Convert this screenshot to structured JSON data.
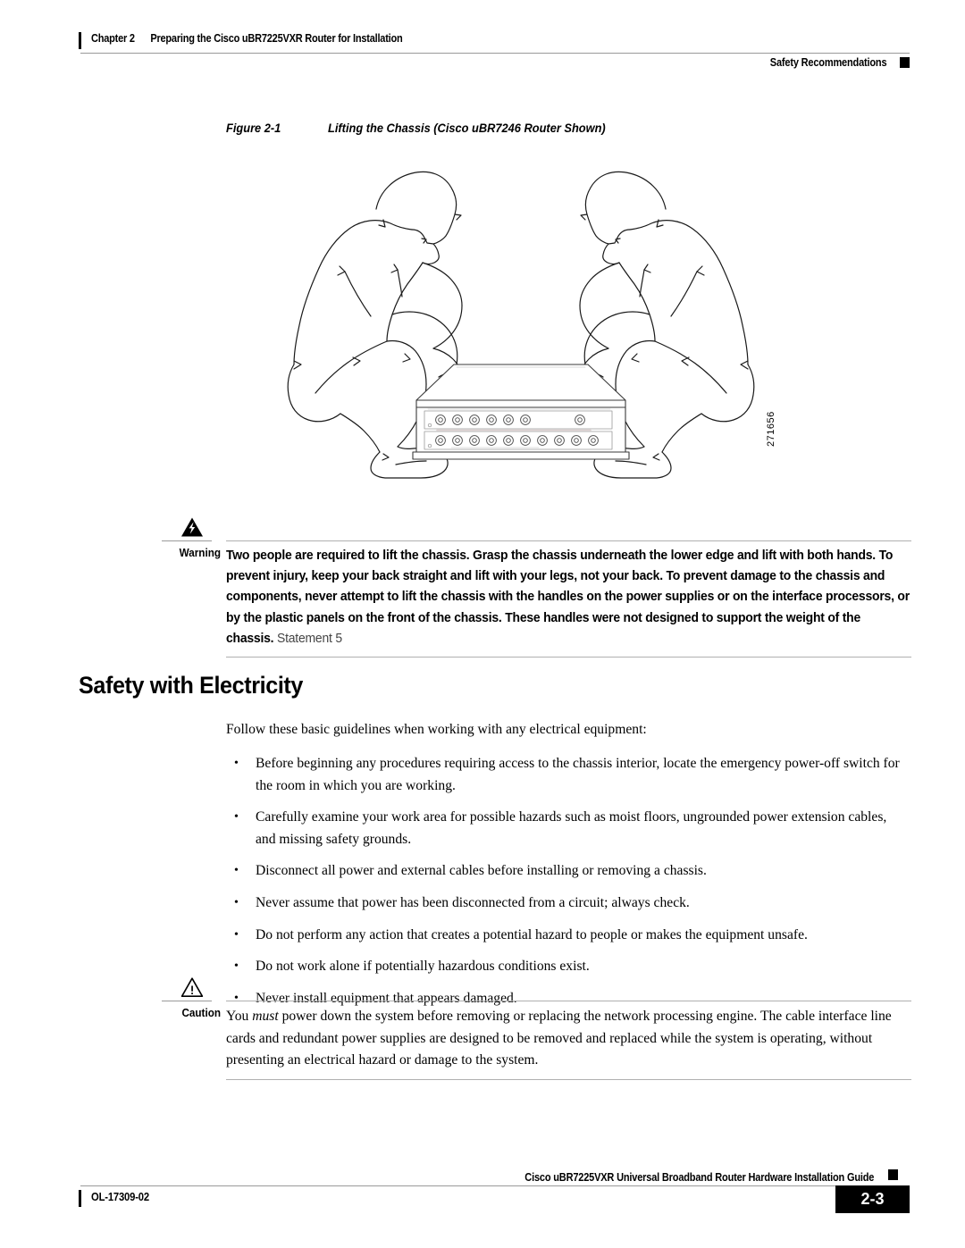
{
  "header": {
    "chapter": "Chapter 2",
    "chapter_title": "Preparing the Cisco uBR7225VXR Router for Installation",
    "section_marker": "Safety Recommendations"
  },
  "figure": {
    "number": "Figure 2-1",
    "title": "Lifting the Chassis (Cisco uBR7246 Router Shown)",
    "art_id": "271656",
    "alt": "Line drawing of two people crouching on either side of a rack-mount router chassis, grasping it underneath the lower edge with both hands"
  },
  "warning": {
    "label": "Warning",
    "icon": "warning-lightning-triangle-icon",
    "text": "Two people are required to lift the chassis. Grasp the chassis underneath the lower edge and lift with both hands. To prevent injury, keep your back straight and lift with your legs, not your back. To prevent damage to the chassis and components, never attempt to lift the chassis with the handles on the power supplies or on the interface processors, or by the plastic panels on the front of the chassis. These handles were not designed to support the weight of the chassis.",
    "statement": "Statement 5"
  },
  "section": {
    "heading": "Safety with Electricity",
    "lead": "Follow these basic guidelines when working with any electrical equipment:",
    "bullet_char": "•",
    "bullets": [
      "Before beginning any procedures requiring access to the chassis interior, locate the emergency power-off switch for the room in which you are working.",
      "Carefully examine your work area for possible hazards such as moist floors, ungrounded power extension cables, and missing safety grounds.",
      "Disconnect all power and external cables before installing or removing a chassis.",
      "Never assume that power has been disconnected from a circuit; always check.",
      "Do not perform any action that creates a potential hazard to people or makes the equipment unsafe.",
      "Do not work alone if potentially hazardous conditions exist.",
      "Never install equipment that appears damaged."
    ]
  },
  "caution": {
    "label": "Caution",
    "icon": "caution-exclamation-triangle-icon",
    "text_before": "You ",
    "emphasis": "must",
    "text_after": " power down the system before removing or replacing the network processing engine. The cable interface line cards and redundant power supplies are designed to be removed and replaced while the system is operating, without presenting an electrical hazard or damage to the system."
  },
  "footer": {
    "guide_title": "Cisco uBR7225VXR Universal Broadband Router Hardware Installation Guide",
    "doc_id": "OL-17309-02",
    "page_number": "2-3"
  },
  "colors": {
    "text": "#000000",
    "rule": "#9a9a9a",
    "page_box": "#000000",
    "statement_gray": "#444444"
  }
}
